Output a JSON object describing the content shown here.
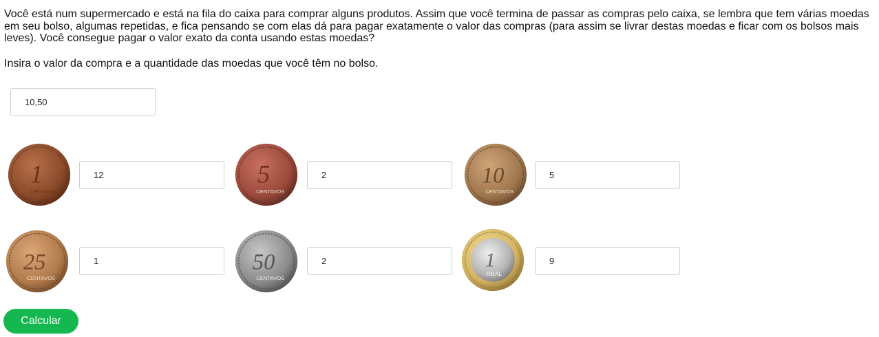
{
  "intro_text": "Você está num supermercado e está na fila do caixa para comprar alguns produtos. Assim que você termina de passar as compras pelo caixa, se lembra que tem várias moedas em seu bolso, algumas repetidas, e fica pensando se com elas dá para pagar exatamente o valor das compras (para assim se livrar destas moedas e ficar com os bolsos mais leves). Você consegue pagar o valor exato da conta usando estas moedas?",
  "prompt_text": "Insira o valor da compra e a quantidade das moedas que você têm no bolso.",
  "purchase_value": "10,50",
  "coins": [
    {
      "denomination": "1",
      "word": "CENTAVO",
      "icon": "coin-1-centavo-icon",
      "quantity": "12",
      "color": "#8a4a2a"
    },
    {
      "denomination": "5",
      "word": "CENTAVOS",
      "icon": "coin-5-centavos-icon",
      "quantity": "2",
      "color": "#9a4a3c"
    },
    {
      "denomination": "10",
      "word": "CENTAVOS",
      "icon": "coin-10-centavos-icon",
      "quantity": "5",
      "color": "#a0784e"
    },
    {
      "denomination": "25",
      "word": "CENTAVOS",
      "icon": "coin-25-centavos-icon",
      "quantity": "1",
      "color": "#b07a4c"
    },
    {
      "denomination": "50",
      "word": "CENTAVOS",
      "icon": "coin-50-centavos-icon",
      "quantity": "2",
      "color": "#8a8a8a"
    },
    {
      "denomination": "1",
      "word": "REAL",
      "icon": "coin-1-real-icon",
      "quantity": "9",
      "color": "#d2b260"
    }
  ],
  "calculate_label": "Calcular",
  "accent_color": "#15b84f"
}
